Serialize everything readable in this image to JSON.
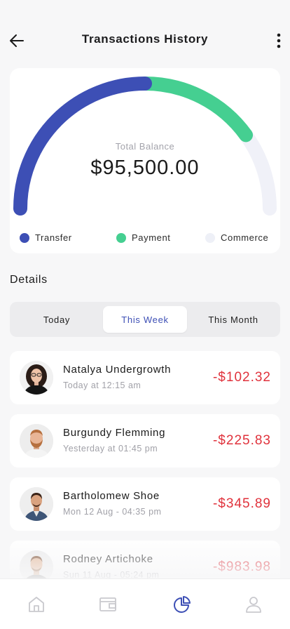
{
  "header": {
    "title": "Transactions History",
    "back_icon": "arrow-left-icon",
    "more_icon": "more-vertical-icon"
  },
  "balance": {
    "label": "Total Balance",
    "value": "$95,500.00"
  },
  "chart_data": {
    "type": "gauge",
    "segments": [
      {
        "name": "Transfer",
        "fraction": 0.5,
        "color": "#3d4fb5"
      },
      {
        "name": "Payment",
        "fraction": 0.3,
        "color": "#45cf91"
      },
      {
        "name": "Commerce",
        "fraction": 0.2,
        "color": "#f0f1f8"
      }
    ]
  },
  "legend": [
    {
      "label": "Transfer",
      "color": "#3d4fb5"
    },
    {
      "label": "Payment",
      "color": "#45cf91"
    },
    {
      "label": "Commerce",
      "color": "#eef0f7"
    }
  ],
  "details": {
    "title": "Details",
    "tabs": [
      {
        "label": "Today",
        "active": false
      },
      {
        "label": "This Week",
        "active": true
      },
      {
        "label": "This Month",
        "active": false
      }
    ]
  },
  "transactions": [
    {
      "name": "Natalya Undergrowth",
      "time": "Today at 12:15 am",
      "amount": "-$102.32"
    },
    {
      "name": "Burgundy Flemming",
      "time": "Yesterday at 01:45 pm",
      "amount": "-$225.83"
    },
    {
      "name": "Bartholomew Shoe",
      "time": "Mon 12 Aug - 04:35 pm",
      "amount": "-$345.89"
    },
    {
      "name": "Rodney Artichoke",
      "time": "Sun 11 Aug - 05:24 pm",
      "amount": "-$983.98"
    }
  ],
  "nav": {
    "items": [
      {
        "icon": "home-icon",
        "active": false
      },
      {
        "icon": "wallet-icon",
        "active": false
      },
      {
        "icon": "pie-chart-icon",
        "active": true
      },
      {
        "icon": "profile-icon",
        "active": false
      }
    ],
    "active_color": "#3d4fb5",
    "inactive_color": "#c9c9ce"
  }
}
